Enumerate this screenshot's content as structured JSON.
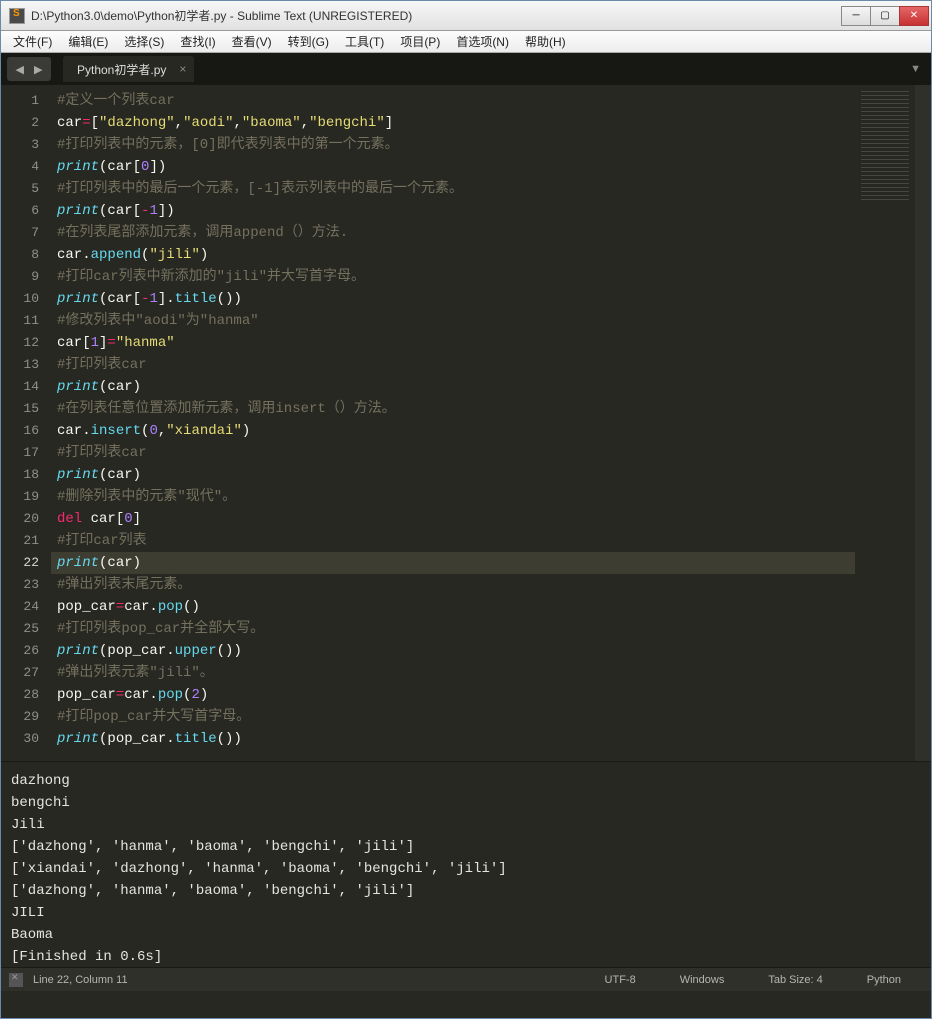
{
  "window": {
    "title": "D:\\Python3.0\\demo\\Python初学者.py - Sublime Text (UNREGISTERED)"
  },
  "menu": {
    "file": "文件(F)",
    "edit": "编辑(E)",
    "select": "选择(S)",
    "find": "查找(I)",
    "view": "查看(V)",
    "goto": "转到(G)",
    "tools": "工具(T)",
    "project": "项目(P)",
    "prefs": "首选项(N)",
    "help": "帮助(H)"
  },
  "tab": {
    "name": "Python初学者.py",
    "close": "×"
  },
  "nav": {
    "back": "◀",
    "fwd": "▶"
  },
  "tabbar": {
    "menu": "▼"
  },
  "lines": [
    {
      "n": 1,
      "seg": [
        [
          "c-comment",
          "#定义一个列表car"
        ]
      ]
    },
    {
      "n": 2,
      "seg": [
        [
          "",
          "car"
        ],
        [
          "c-op",
          "="
        ],
        [
          "",
          "["
        ],
        [
          "c-string",
          "\"dazhong\""
        ],
        [
          "",
          ","
        ],
        [
          "c-string",
          "\"aodi\""
        ],
        [
          "",
          ","
        ],
        [
          "c-string",
          "\"baoma\""
        ],
        [
          "",
          ","
        ],
        [
          "c-string",
          "\"bengchi\""
        ],
        [
          "",
          "]"
        ]
      ]
    },
    {
      "n": 3,
      "seg": [
        [
          "c-comment",
          "#打印列表中的元素，[0]即代表列表中的第一个元素。"
        ]
      ]
    },
    {
      "n": 4,
      "seg": [
        [
          "c-builtin",
          "print"
        ],
        [
          "",
          "(car["
        ],
        [
          "c-number",
          "0"
        ],
        [
          "",
          "])"
        ]
      ]
    },
    {
      "n": 5,
      "seg": [
        [
          "c-comment",
          "#打印列表中的最后一个元素，[-1]表示列表中的最后一个元素。"
        ]
      ]
    },
    {
      "n": 6,
      "seg": [
        [
          "c-builtin",
          "print"
        ],
        [
          "",
          "(car["
        ],
        [
          "c-op",
          "-"
        ],
        [
          "c-number",
          "1"
        ],
        [
          "",
          "])"
        ]
      ]
    },
    {
      "n": 7,
      "seg": [
        [
          "c-comment",
          "#在列表尾部添加元素，调用append（）方法."
        ]
      ]
    },
    {
      "n": 8,
      "seg": [
        [
          "",
          "car."
        ],
        [
          "c-func",
          "append"
        ],
        [
          "",
          "("
        ],
        [
          "c-string",
          "\"jili\""
        ],
        [
          "",
          ")"
        ]
      ]
    },
    {
      "n": 9,
      "seg": [
        [
          "c-comment",
          "#打印car列表中新添加的\"jili\"并大写首字母。"
        ]
      ]
    },
    {
      "n": 10,
      "seg": [
        [
          "c-builtin",
          "print"
        ],
        [
          "",
          "(car["
        ],
        [
          "c-op",
          "-"
        ],
        [
          "c-number",
          "1"
        ],
        [
          "",
          "]."
        ],
        [
          "c-func",
          "title"
        ],
        [
          "",
          "())"
        ]
      ]
    },
    {
      "n": 11,
      "seg": [
        [
          "c-comment",
          "#修改列表中\"aodi\"为\"hanma\""
        ]
      ]
    },
    {
      "n": 12,
      "seg": [
        [
          "",
          "car["
        ],
        [
          "c-number",
          "1"
        ],
        [
          "",
          "]"
        ],
        [
          "c-op",
          "="
        ],
        [
          "c-string",
          "\"hanma\""
        ]
      ]
    },
    {
      "n": 13,
      "seg": [
        [
          "c-comment",
          "#打印列表car"
        ]
      ]
    },
    {
      "n": 14,
      "seg": [
        [
          "c-builtin",
          "print"
        ],
        [
          "",
          "(car)"
        ]
      ]
    },
    {
      "n": 15,
      "seg": [
        [
          "c-comment",
          "#在列表任意位置添加新元素，调用insert（）方法。"
        ]
      ]
    },
    {
      "n": 16,
      "seg": [
        [
          "",
          "car."
        ],
        [
          "c-func",
          "insert"
        ],
        [
          "",
          "("
        ],
        [
          "c-number",
          "0"
        ],
        [
          "",
          ","
        ],
        [
          "c-string",
          "\"xiandai\""
        ],
        [
          "",
          ")"
        ]
      ]
    },
    {
      "n": 17,
      "seg": [
        [
          "c-comment",
          "#打印列表car"
        ]
      ]
    },
    {
      "n": 18,
      "seg": [
        [
          "c-builtin",
          "print"
        ],
        [
          "",
          "(car)"
        ]
      ]
    },
    {
      "n": 19,
      "seg": [
        [
          "c-comment",
          "#删除列表中的元素\"现代\"。"
        ]
      ]
    },
    {
      "n": 20,
      "seg": [
        [
          "c-keyword",
          "del"
        ],
        [
          "",
          " car["
        ],
        [
          "c-number",
          "0"
        ],
        [
          "",
          "]"
        ]
      ]
    },
    {
      "n": 21,
      "seg": [
        [
          "c-comment",
          "#打印car列表"
        ]
      ]
    },
    {
      "n": 22,
      "active": true,
      "seg": [
        [
          "c-builtin",
          "print"
        ],
        [
          "",
          "(car)"
        ]
      ]
    },
    {
      "n": 23,
      "seg": [
        [
          "c-comment",
          "#弹出列表末尾元素。"
        ]
      ]
    },
    {
      "n": 24,
      "seg": [
        [
          "",
          "pop_car"
        ],
        [
          "c-op",
          "="
        ],
        [
          "",
          "car."
        ],
        [
          "c-func",
          "pop"
        ],
        [
          "",
          "()"
        ]
      ]
    },
    {
      "n": 25,
      "seg": [
        [
          "c-comment",
          "#打印列表pop_car并全部大写。"
        ]
      ]
    },
    {
      "n": 26,
      "seg": [
        [
          "c-builtin",
          "print"
        ],
        [
          "",
          "(pop_car."
        ],
        [
          "c-func",
          "upper"
        ],
        [
          "",
          "())"
        ]
      ]
    },
    {
      "n": 27,
      "seg": [
        [
          "c-comment",
          "#弹出列表元素\"jili\"。"
        ]
      ]
    },
    {
      "n": 28,
      "seg": [
        [
          "",
          "pop_car"
        ],
        [
          "c-op",
          "="
        ],
        [
          "",
          "car."
        ],
        [
          "c-func",
          "pop"
        ],
        [
          "",
          "("
        ],
        [
          "c-number",
          "2"
        ],
        [
          "",
          ")"
        ]
      ]
    },
    {
      "n": 29,
      "seg": [
        [
          "c-comment",
          "#打印pop_car并大写首字母。"
        ]
      ]
    },
    {
      "n": 30,
      "seg": [
        [
          "c-builtin",
          "print"
        ],
        [
          "",
          "(pop_car."
        ],
        [
          "c-func",
          "title"
        ],
        [
          "",
          "())"
        ]
      ]
    }
  ],
  "console_output": "dazhong\nbengchi\nJili\n['dazhong', 'hanma', 'baoma', 'bengchi', 'jili']\n['xiandai', 'dazhong', 'hanma', 'baoma', 'bengchi', 'jili']\n['dazhong', 'hanma', 'baoma', 'bengchi', 'jili']\nJILI\nBaoma\n[Finished in 0.6s]",
  "status": {
    "pos": "Line 22, Column 11",
    "encoding": "UTF-8",
    "line_endings": "Windows",
    "tab_size": "Tab Size: 4",
    "syntax": "Python"
  }
}
